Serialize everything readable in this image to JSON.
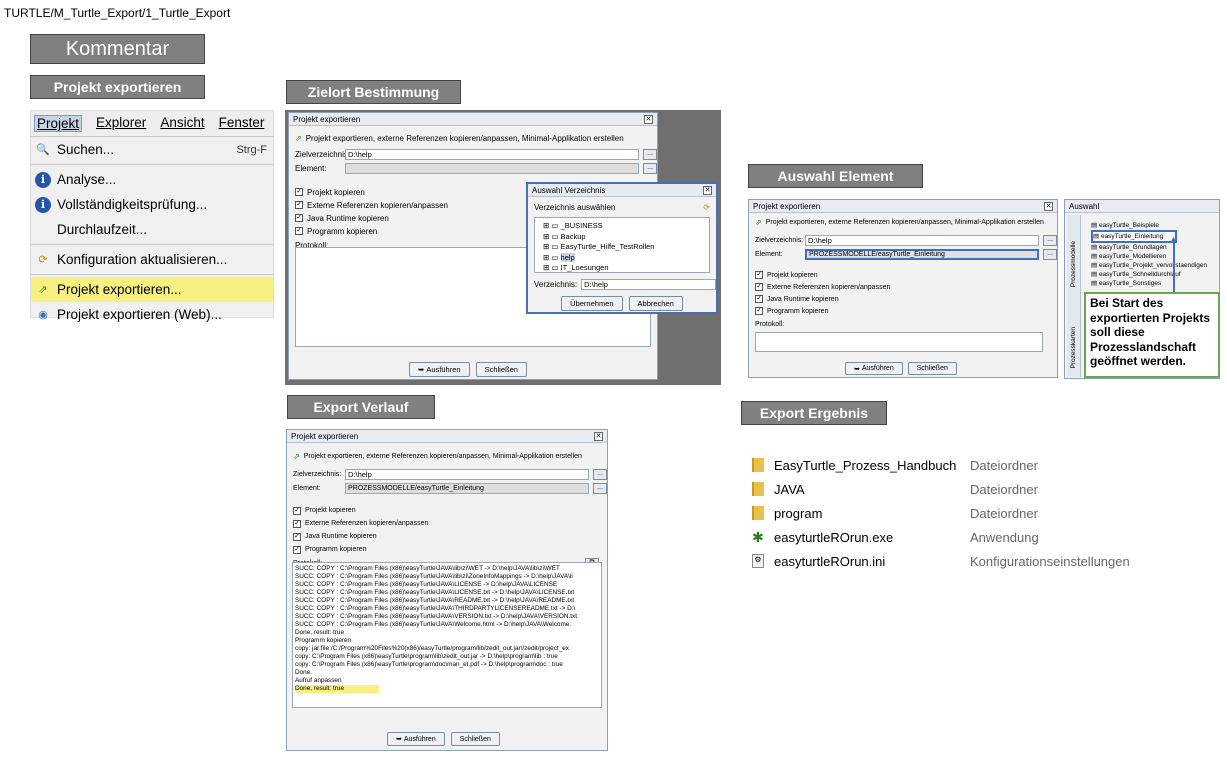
{
  "breadcrumb": "TURTLE/M_Turtle_Export/1_Turtle_Export",
  "headers": {
    "kommentar": "Kommentar",
    "projekt": "Projekt exportieren",
    "zielort": "Zielort Bestimmung",
    "auswahl": "Auswahl Element",
    "verlauf": "Export  Verlauf",
    "ergebnis": "Export Ergebnis"
  },
  "menu": {
    "bar": [
      "Projekt",
      "Explorer",
      "Ansicht",
      "Fenster"
    ],
    "items": [
      {
        "label": "Suchen...",
        "shortcut": "Strg-F"
      },
      {
        "label": "Analyse..."
      },
      {
        "label": "Vollständigkeitsprüfung..."
      },
      {
        "label": "Durchlaufzeit..."
      },
      {
        "label": "Konfiguration aktualisieren..."
      },
      {
        "label": "Projekt exportieren..."
      },
      {
        "label": "Projekt exportieren (Web)..."
      }
    ]
  },
  "dialog": {
    "title": "Projekt exportieren",
    "desc": "Projekt exportieren, externe Referenzen kopieren/anpassen, Minimal-Applikation erstellen",
    "ziel_label": "Zielverzeichnis:",
    "ziel_value": "D:\\help",
    "element_label": "Element:",
    "element_value": "PROZESSMODELLE/easyTurtle_Einleitung",
    "cb": [
      "Projekt kopieren",
      "Externe Referenzen kopieren/anpassen",
      "Java Runtime kopieren",
      "Programm kopieren"
    ],
    "protokoll": "Protokoll:",
    "run": "Ausführen",
    "close": "Schließen"
  },
  "verz": {
    "title": "Auswahl Verzeichnis",
    "sub": "Verzeichnis auswählen",
    "items": [
      "_BUSINESS",
      "Backup",
      "EasyTurtle_Hilfe_TestRollen",
      "help",
      "IT_Loesungen"
    ],
    "label": "Verzeichnis:",
    "value": "D:\\help",
    "ok": "Übernehmen",
    "cancel": "Abbrechen"
  },
  "auswahl": {
    "title": "Auswahl",
    "items": [
      "easyTurtle_Beispiele",
      "easyTurtle_Einleitung",
      "easyTurtle_Grundlagen",
      "easyTurtle_Modellieren",
      "easyTurtle_Projekt_vervollstaendigen",
      "easyTurtle_Schnelldurchlauf",
      "easyTurtle_Sonstiges"
    ],
    "side1": "Prozessmodelle",
    "side2": "Prozesskarten",
    "note": "Bei Start des exportierten Projekts soll diese Prozesslandschaft geöffnet werden."
  },
  "log": [
    "SUCC: COPY : C:\\Program Files (x86)\\easyTurtle\\JAVA\\lib\\zi\\WET -> D:\\help\\JAVA\\lib\\zi\\WET",
    "SUCC: COPY : C:\\Program Files (x86)\\easyTurtle\\JAVA\\lib\\zi\\ZoneInfoMappings -> D:\\help\\JAVA\\li",
    "SUCC: COPY : C:\\Program Files (x86)\\easyTurtle\\JAVA\\LICENSE -> D:\\help\\JAVA\\LICENSE",
    "SUCC: COPY : C:\\Program Files (x86)\\easyTurtle\\JAVA\\LICENSE.txt -> D:\\help\\JAVA\\LICENSE.txt",
    "SUCC: COPY : C:\\Program Files (x86)\\easyTurtle\\JAVA\\README.txt -> D:\\help\\JAVA\\README.txt",
    "SUCC: COPY : C:\\Program Files (x86)\\easyTurtle\\JAVA\\THIRDPARTYLICENSEREADME.txt -> D:\\",
    "SUCC: COPY : C:\\Program Files (x86)\\easyTurtle\\JAVA\\VERSION.txt -> D:\\help\\JAVA\\VERSION.txt",
    "SUCC: COPY : C:\\Program Files (x86)\\easyTurtle\\JAVA\\Welcome.html -> D:\\help\\JAVA\\Welcome.",
    "Done, result: true",
    "Programm kopieren",
    "copy: jar:file:/C:/Program%20Files%20(x86)/easyTurtle/program/lib/zedit_out.jar!/zedit/project_ex",
    "copy: C:\\Program Files (x86)\\easyTurtle\\program\\lib\\zedit_out.jar -> D:\\help\\program\\lib : true",
    "copy: C:\\Program Files (x86)\\easyTurtle\\program\\doc\\man_et.pdf -> D:\\help\\program\\doc : true",
    "Done.",
    "Aufruf anpassen",
    "Done, result: true"
  ],
  "results": [
    {
      "name": "EasyTurtle_Prozess_Handbuch",
      "type": "Dateiordner",
      "icon": "folder-icon"
    },
    {
      "name": "JAVA",
      "type": "Dateiordner",
      "icon": "folder-icon"
    },
    {
      "name": "program",
      "type": "Dateiordner",
      "icon": "folder-icon"
    },
    {
      "name": "easyturtleROrun.exe",
      "type": "Anwendung",
      "icon": "turtle-exe-icon"
    },
    {
      "name": "easyturtleROrun.ini",
      "type": "Konfigurationseinstellungen",
      "icon": "ini-file-icon"
    }
  ]
}
